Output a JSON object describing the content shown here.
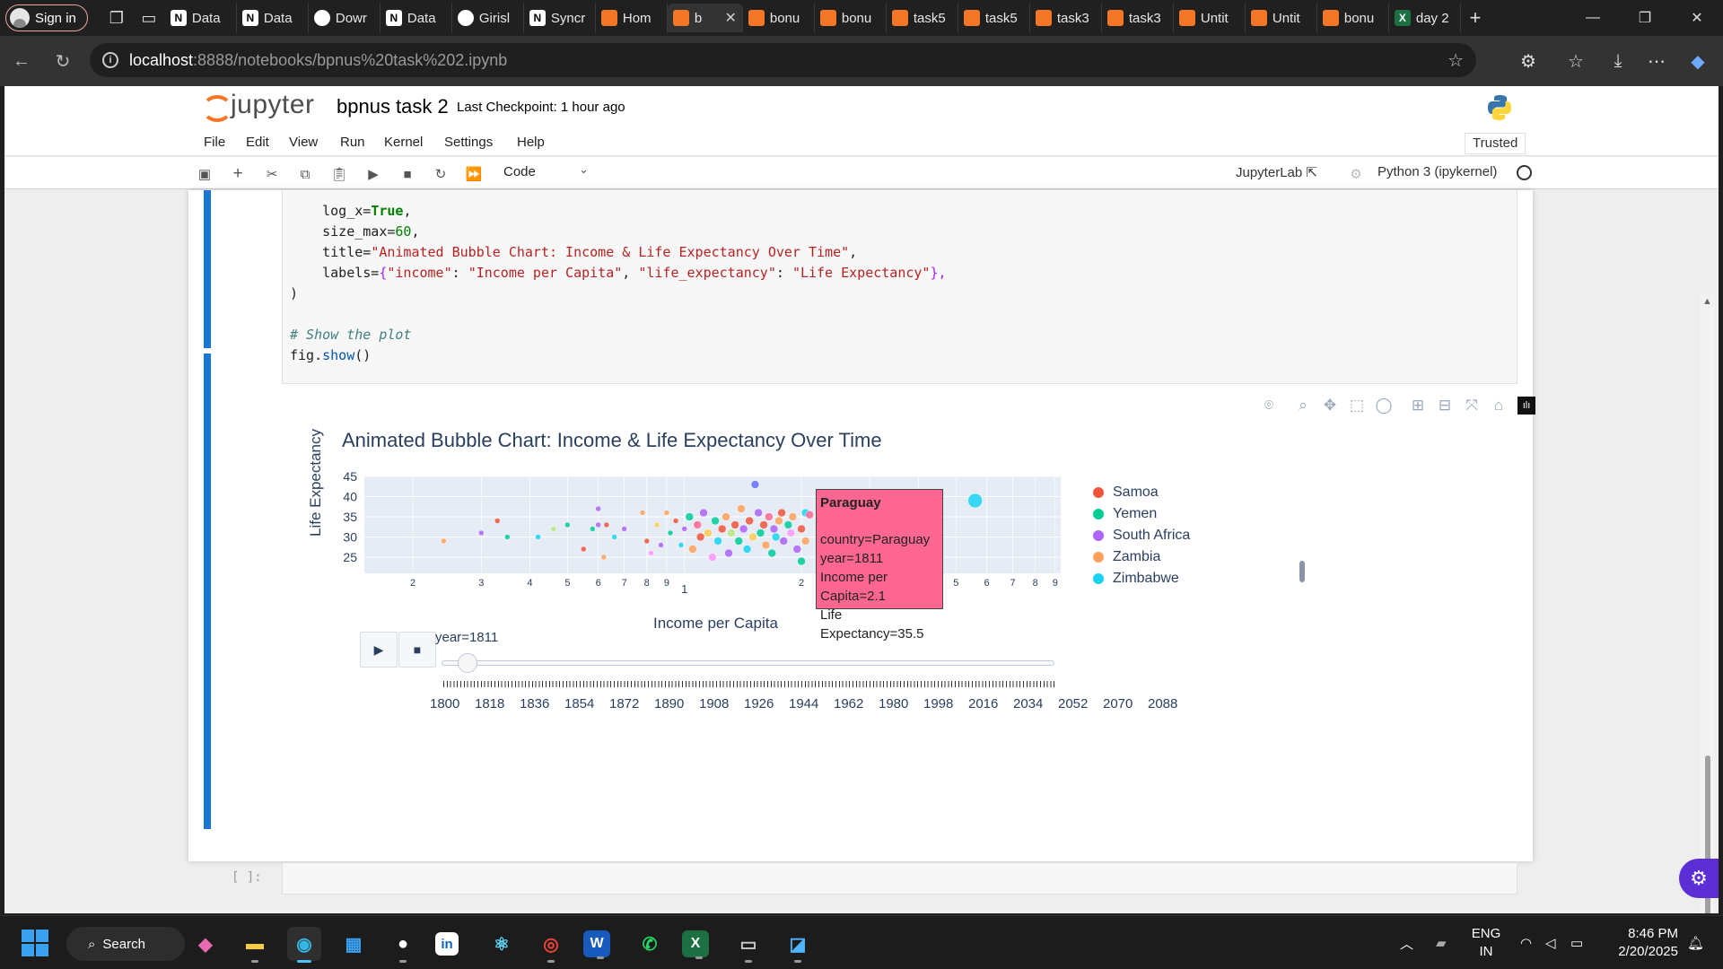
{
  "browser": {
    "signin_label": "Sign in",
    "tabs": [
      {
        "label": "Data",
        "icon": "notion-icon"
      },
      {
        "label": "Data",
        "icon": "notion-icon"
      },
      {
        "label": "Dowr",
        "icon": "app-icon"
      },
      {
        "label": "Data",
        "icon": "notion-icon"
      },
      {
        "label": "Girisl",
        "icon": "github-icon"
      },
      {
        "label": "Syncr",
        "icon": "notion-icon"
      },
      {
        "label": "Hom",
        "icon": "jupyter-icon"
      },
      {
        "label": "b",
        "icon": "jupyter-icon",
        "active": true
      },
      {
        "label": "bonu",
        "icon": "jupyter-icon"
      },
      {
        "label": "bonu",
        "icon": "jupyter-icon"
      },
      {
        "label": "task5",
        "icon": "jupyter-icon"
      },
      {
        "label": "task5",
        "icon": "jupyter-icon"
      },
      {
        "label": "task3",
        "icon": "jupyter-icon"
      },
      {
        "label": "task3",
        "icon": "jupyter-icon"
      },
      {
        "label": "Untit",
        "icon": "jupyter-icon"
      },
      {
        "label": "Untit",
        "icon": "jupyter-icon"
      },
      {
        "label": "bonu",
        "icon": "jupyter-icon"
      },
      {
        "label": "day 2",
        "icon": "excel-icon"
      }
    ],
    "url_host": "localhost",
    "url_path": ":8888/notebooks/bpnus%20task%202.ipynb"
  },
  "jupyter": {
    "logo_text": "jupyter",
    "notebook_title": "bpnus task 2",
    "checkpoint": "Last Checkpoint: 1 hour ago",
    "menu": [
      "File",
      "Edit",
      "View",
      "Run",
      "Kernel",
      "Settings",
      "Help"
    ],
    "trusted": "Trusted",
    "cell_type": "Code",
    "jupyterlab_link": "JupyterLab",
    "kernel": "Python 3 (ipykernel)",
    "empty_prompt": "[ ]:"
  },
  "code": {
    "line1_key": "log_x=",
    "line1_val": "True",
    "line2_key": "size_max=",
    "line2_val": "60",
    "line3_key": "title=",
    "line3_val": "\"Animated Bubble Chart: Income & Life Expectancy Over Time\"",
    "line4_key": "labels=",
    "line4_a": "{",
    "line4_b": "\"income\"",
    "line4_c": ": ",
    "line4_d": "\"Income per Capita\"",
    "line4_e": ", ",
    "line4_f": "\"life_expectancy\"",
    "line4_g": ": ",
    "line4_h": "\"Life Expectancy\"",
    "line4_i": "},",
    "line5": ")",
    "comment": "# Show the plot",
    "show_obj": "fig.",
    "show_fn": "show",
    "show_args": "()"
  },
  "chart_data": {
    "type": "scatter",
    "title": "Animated Bubble Chart: Income & Life Expectancy Over Time",
    "xlabel": "Income per Capita",
    "ylabel": "Life Expectancy",
    "log_x": true,
    "x_ticks": [
      "2",
      "3",
      "4",
      "5",
      "6",
      "7",
      "8",
      "9",
      "1",
      "2",
      "3",
      "4",
      "5",
      "6",
      "7",
      "8",
      "9"
    ],
    "y_ticks": [
      "45",
      "40",
      "35",
      "30",
      "25"
    ],
    "ylim": [
      21,
      45
    ],
    "legend_placement": "right",
    "legend": [
      {
        "name": "Samoa",
        "color": "#ef553b"
      },
      {
        "name": "Yemen",
        "color": "#00cc96"
      },
      {
        "name": "South Africa",
        "color": "#ab63fa"
      },
      {
        "name": "Zambia",
        "color": "#ffa15a"
      },
      {
        "name": "Zimbabwe",
        "color": "#19d3f3"
      }
    ],
    "hover": {
      "country": "Paraguay",
      "line1": "country=Paraguay",
      "line2": "year=1811",
      "line3": "Income per Capita=2.1",
      "line4": "Life Expectancy=35.5",
      "color": "#ff6692"
    },
    "points": [
      {
        "x": 0.24,
        "y": 29,
        "c": "#ffa15a"
      },
      {
        "x": 0.3,
        "y": 31,
        "c": "#ab63fa"
      },
      {
        "x": 0.33,
        "y": 34,
        "c": "#ef553b"
      },
      {
        "x": 0.35,
        "y": 30,
        "c": "#00cc96"
      },
      {
        "x": 0.42,
        "y": 30,
        "c": "#19d3f3"
      },
      {
        "x": 0.46,
        "y": 32,
        "c": "#b6e880"
      },
      {
        "x": 0.5,
        "y": 33,
        "c": "#00cc96"
      },
      {
        "x": 0.55,
        "y": 27,
        "c": "#ef553b"
      },
      {
        "x": 0.58,
        "y": 32,
        "c": "#00cc96"
      },
      {
        "x": 0.6,
        "y": 33,
        "c": "#ab63fa"
      },
      {
        "x": 0.6,
        "y": 37,
        "c": "#ab63fa"
      },
      {
        "x": 0.62,
        "y": 25,
        "c": "#ffa15a"
      },
      {
        "x": 0.63,
        "y": 33,
        "c": "#ef553b"
      },
      {
        "x": 0.66,
        "y": 30,
        "c": "#19d3f3"
      },
      {
        "x": 0.7,
        "y": 32,
        "c": "#ab63fa"
      },
      {
        "x": 0.78,
        "y": 36,
        "c": "#ffa15a"
      },
      {
        "x": 0.8,
        "y": 29,
        "c": "#ef553b"
      },
      {
        "x": 0.82,
        "y": 26,
        "c": "#ff97ff"
      },
      {
        "x": 0.85,
        "y": 33,
        "c": "#fecb52"
      },
      {
        "x": 0.87,
        "y": 28,
        "c": "#ab63fa"
      },
      {
        "x": 0.9,
        "y": 36,
        "c": "#ffa15a"
      },
      {
        "x": 0.92,
        "y": 31,
        "c": "#00cc96"
      },
      {
        "x": 0.95,
        "y": 34,
        "c": "#ef553b"
      },
      {
        "x": 0.98,
        "y": 28,
        "c": "#19d3f3"
      },
      {
        "x": 1.0,
        "y": 32,
        "c": "#ab63fa"
      },
      {
        "x": 1.03,
        "y": 35,
        "c": "#00cc96"
      },
      {
        "x": 1.05,
        "y": 27,
        "c": "#ffa15a"
      },
      {
        "x": 1.08,
        "y": 33,
        "c": "#ff6692"
      },
      {
        "x": 1.1,
        "y": 30,
        "c": "#ef553b"
      },
      {
        "x": 1.12,
        "y": 36,
        "c": "#ab63fa"
      },
      {
        "x": 1.15,
        "y": 31,
        "c": "#fecb52"
      },
      {
        "x": 1.18,
        "y": 25,
        "c": "#ff97ff"
      },
      {
        "x": 1.2,
        "y": 34,
        "c": "#00cc96"
      },
      {
        "x": 1.22,
        "y": 29,
        "c": "#19d3f3"
      },
      {
        "x": 1.25,
        "y": 32,
        "c": "#ef553b"
      },
      {
        "x": 1.28,
        "y": 35,
        "c": "#ffa15a"
      },
      {
        "x": 1.3,
        "y": 26,
        "c": "#ab63fa"
      },
      {
        "x": 1.32,
        "y": 31,
        "c": "#b6e880"
      },
      {
        "x": 1.35,
        "y": 33,
        "c": "#ef553b"
      },
      {
        "x": 1.38,
        "y": 29,
        "c": "#00cc96"
      },
      {
        "x": 1.4,
        "y": 37,
        "c": "#ffa15a"
      },
      {
        "x": 1.42,
        "y": 32,
        "c": "#ab63fa"
      },
      {
        "x": 1.45,
        "y": 27,
        "c": "#19d3f3"
      },
      {
        "x": 1.47,
        "y": 34,
        "c": "#ef553b"
      },
      {
        "x": 1.5,
        "y": 30,
        "c": "#fecb52"
      },
      {
        "x": 1.52,
        "y": 43,
        "c": "#636efa"
      },
      {
        "x": 1.55,
        "y": 36,
        "c": "#ab63fa"
      },
      {
        "x": 1.57,
        "y": 31,
        "c": "#00cc96"
      },
      {
        "x": 1.6,
        "y": 33,
        "c": "#ef553b"
      },
      {
        "x": 1.62,
        "y": 28,
        "c": "#ffa15a"
      },
      {
        "x": 1.65,
        "y": 35,
        "c": "#ff6692"
      },
      {
        "x": 1.68,
        "y": 26,
        "c": "#00cc96"
      },
      {
        "x": 1.7,
        "y": 32,
        "c": "#ab63fa"
      },
      {
        "x": 1.72,
        "y": 30,
        "c": "#19d3f3"
      },
      {
        "x": 1.75,
        "y": 34,
        "c": "#ffa15a"
      },
      {
        "x": 1.78,
        "y": 36,
        "c": "#ef553b"
      },
      {
        "x": 1.8,
        "y": 29,
        "c": "#ab63fa"
      },
      {
        "x": 1.85,
        "y": 33,
        "c": "#00cc96"
      },
      {
        "x": 1.88,
        "y": 31,
        "c": "#ff97ff"
      },
      {
        "x": 1.9,
        "y": 35,
        "c": "#ffa15a"
      },
      {
        "x": 1.95,
        "y": 27,
        "c": "#ab63fa"
      },
      {
        "x": 2.0,
        "y": 24,
        "c": "#00cc96"
      },
      {
        "x": 2.0,
        "y": 32,
        "c": "#ef553b"
      },
      {
        "x": 2.05,
        "y": 36,
        "c": "#19d3f3"
      },
      {
        "x": 2.1,
        "y": 35.5,
        "c": "#ff6692"
      },
      {
        "x": 2.05,
        "y": 29,
        "c": "#ffa15a"
      },
      {
        "x": 4.4,
        "y": 38,
        "c": "#ffa15a"
      },
      {
        "x": 5.6,
        "y": 39,
        "c": "#19d3f3"
      }
    ]
  },
  "slider": {
    "current": "year=1811",
    "play": "▶",
    "stop": "■",
    "fraction": 0.04,
    "years": [
      "1800",
      "1818",
      "1836",
      "1854",
      "1872",
      "1890",
      "1908",
      "1926",
      "1944",
      "1962",
      "1980",
      "1998",
      "2016",
      "2034",
      "2052",
      "2070",
      "2088"
    ]
  },
  "taskbar": {
    "search_label": "Search",
    "lang": "ENG",
    "region": "IN",
    "time": "8:46 PM",
    "date": "2/20/2025"
  }
}
